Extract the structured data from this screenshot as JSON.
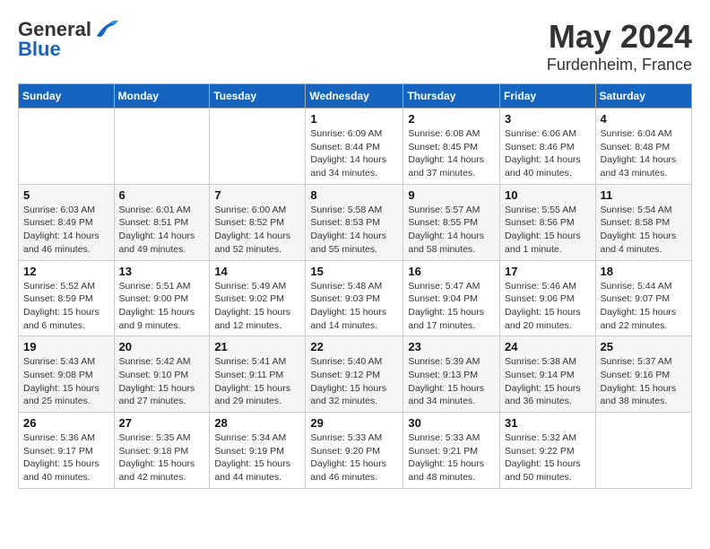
{
  "logo": {
    "general": "General",
    "blue": "Blue"
  },
  "title": "May 2024",
  "subtitle": "Furdenheim, France",
  "headers": [
    "Sunday",
    "Monday",
    "Tuesday",
    "Wednesday",
    "Thursday",
    "Friday",
    "Saturday"
  ],
  "weeks": [
    [
      {
        "day": "",
        "info": ""
      },
      {
        "day": "",
        "info": ""
      },
      {
        "day": "",
        "info": ""
      },
      {
        "day": "1",
        "info": "Sunrise: 6:09 AM\nSunset: 8:44 PM\nDaylight: 14 hours\nand 34 minutes."
      },
      {
        "day": "2",
        "info": "Sunrise: 6:08 AM\nSunset: 8:45 PM\nDaylight: 14 hours\nand 37 minutes."
      },
      {
        "day": "3",
        "info": "Sunrise: 6:06 AM\nSunset: 8:46 PM\nDaylight: 14 hours\nand 40 minutes."
      },
      {
        "day": "4",
        "info": "Sunrise: 6:04 AM\nSunset: 8:48 PM\nDaylight: 14 hours\nand 43 minutes."
      }
    ],
    [
      {
        "day": "5",
        "info": "Sunrise: 6:03 AM\nSunset: 8:49 PM\nDaylight: 14 hours\nand 46 minutes."
      },
      {
        "day": "6",
        "info": "Sunrise: 6:01 AM\nSunset: 8:51 PM\nDaylight: 14 hours\nand 49 minutes."
      },
      {
        "day": "7",
        "info": "Sunrise: 6:00 AM\nSunset: 8:52 PM\nDaylight: 14 hours\nand 52 minutes."
      },
      {
        "day": "8",
        "info": "Sunrise: 5:58 AM\nSunset: 8:53 PM\nDaylight: 14 hours\nand 55 minutes."
      },
      {
        "day": "9",
        "info": "Sunrise: 5:57 AM\nSunset: 8:55 PM\nDaylight: 14 hours\nand 58 minutes."
      },
      {
        "day": "10",
        "info": "Sunrise: 5:55 AM\nSunset: 8:56 PM\nDaylight: 15 hours\nand 1 minute."
      },
      {
        "day": "11",
        "info": "Sunrise: 5:54 AM\nSunset: 8:58 PM\nDaylight: 15 hours\nand 4 minutes."
      }
    ],
    [
      {
        "day": "12",
        "info": "Sunrise: 5:52 AM\nSunset: 8:59 PM\nDaylight: 15 hours\nand 6 minutes."
      },
      {
        "day": "13",
        "info": "Sunrise: 5:51 AM\nSunset: 9:00 PM\nDaylight: 15 hours\nand 9 minutes."
      },
      {
        "day": "14",
        "info": "Sunrise: 5:49 AM\nSunset: 9:02 PM\nDaylight: 15 hours\nand 12 minutes."
      },
      {
        "day": "15",
        "info": "Sunrise: 5:48 AM\nSunset: 9:03 PM\nDaylight: 15 hours\nand 14 minutes."
      },
      {
        "day": "16",
        "info": "Sunrise: 5:47 AM\nSunset: 9:04 PM\nDaylight: 15 hours\nand 17 minutes."
      },
      {
        "day": "17",
        "info": "Sunrise: 5:46 AM\nSunset: 9:06 PM\nDaylight: 15 hours\nand 20 minutes."
      },
      {
        "day": "18",
        "info": "Sunrise: 5:44 AM\nSunset: 9:07 PM\nDaylight: 15 hours\nand 22 minutes."
      }
    ],
    [
      {
        "day": "19",
        "info": "Sunrise: 5:43 AM\nSunset: 9:08 PM\nDaylight: 15 hours\nand 25 minutes."
      },
      {
        "day": "20",
        "info": "Sunrise: 5:42 AM\nSunset: 9:10 PM\nDaylight: 15 hours\nand 27 minutes."
      },
      {
        "day": "21",
        "info": "Sunrise: 5:41 AM\nSunset: 9:11 PM\nDaylight: 15 hours\nand 29 minutes."
      },
      {
        "day": "22",
        "info": "Sunrise: 5:40 AM\nSunset: 9:12 PM\nDaylight: 15 hours\nand 32 minutes."
      },
      {
        "day": "23",
        "info": "Sunrise: 5:39 AM\nSunset: 9:13 PM\nDaylight: 15 hours\nand 34 minutes."
      },
      {
        "day": "24",
        "info": "Sunrise: 5:38 AM\nSunset: 9:14 PM\nDaylight: 15 hours\nand 36 minutes."
      },
      {
        "day": "25",
        "info": "Sunrise: 5:37 AM\nSunset: 9:16 PM\nDaylight: 15 hours\nand 38 minutes."
      }
    ],
    [
      {
        "day": "26",
        "info": "Sunrise: 5:36 AM\nSunset: 9:17 PM\nDaylight: 15 hours\nand 40 minutes."
      },
      {
        "day": "27",
        "info": "Sunrise: 5:35 AM\nSunset: 9:18 PM\nDaylight: 15 hours\nand 42 minutes."
      },
      {
        "day": "28",
        "info": "Sunrise: 5:34 AM\nSunset: 9:19 PM\nDaylight: 15 hours\nand 44 minutes."
      },
      {
        "day": "29",
        "info": "Sunrise: 5:33 AM\nSunset: 9:20 PM\nDaylight: 15 hours\nand 46 minutes."
      },
      {
        "day": "30",
        "info": "Sunrise: 5:33 AM\nSunset: 9:21 PM\nDaylight: 15 hours\nand 48 minutes."
      },
      {
        "day": "31",
        "info": "Sunrise: 5:32 AM\nSunset: 9:22 PM\nDaylight: 15 hours\nand 50 minutes."
      },
      {
        "day": "",
        "info": ""
      }
    ]
  ]
}
